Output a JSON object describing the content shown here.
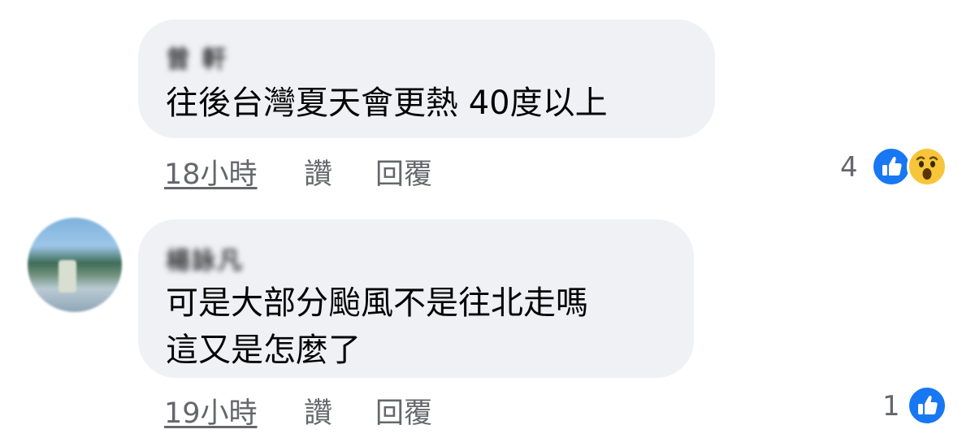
{
  "comments": [
    {
      "author": "曾 軒",
      "text": "往後台灣夏天會更熱 40度以上",
      "time": "18小時",
      "like_label": "讚",
      "reply_label": "回覆",
      "reaction_count": "4",
      "reactions": [
        "like-icon",
        "wow-icon"
      ]
    },
    {
      "author": "楊詠凡",
      "text": "可是大部分颱風不是往北走嗎\n這又是怎麼了",
      "time": "19小時",
      "like_label": "讚",
      "reply_label": "回覆",
      "reaction_count": "1",
      "reactions": [
        "like-icon"
      ]
    }
  ],
  "colors": {
    "bubble": "#eff1f4",
    "meta_text": "#65676b",
    "like_blue": "#1877f2",
    "wow_yellow": "#f7c53a"
  }
}
